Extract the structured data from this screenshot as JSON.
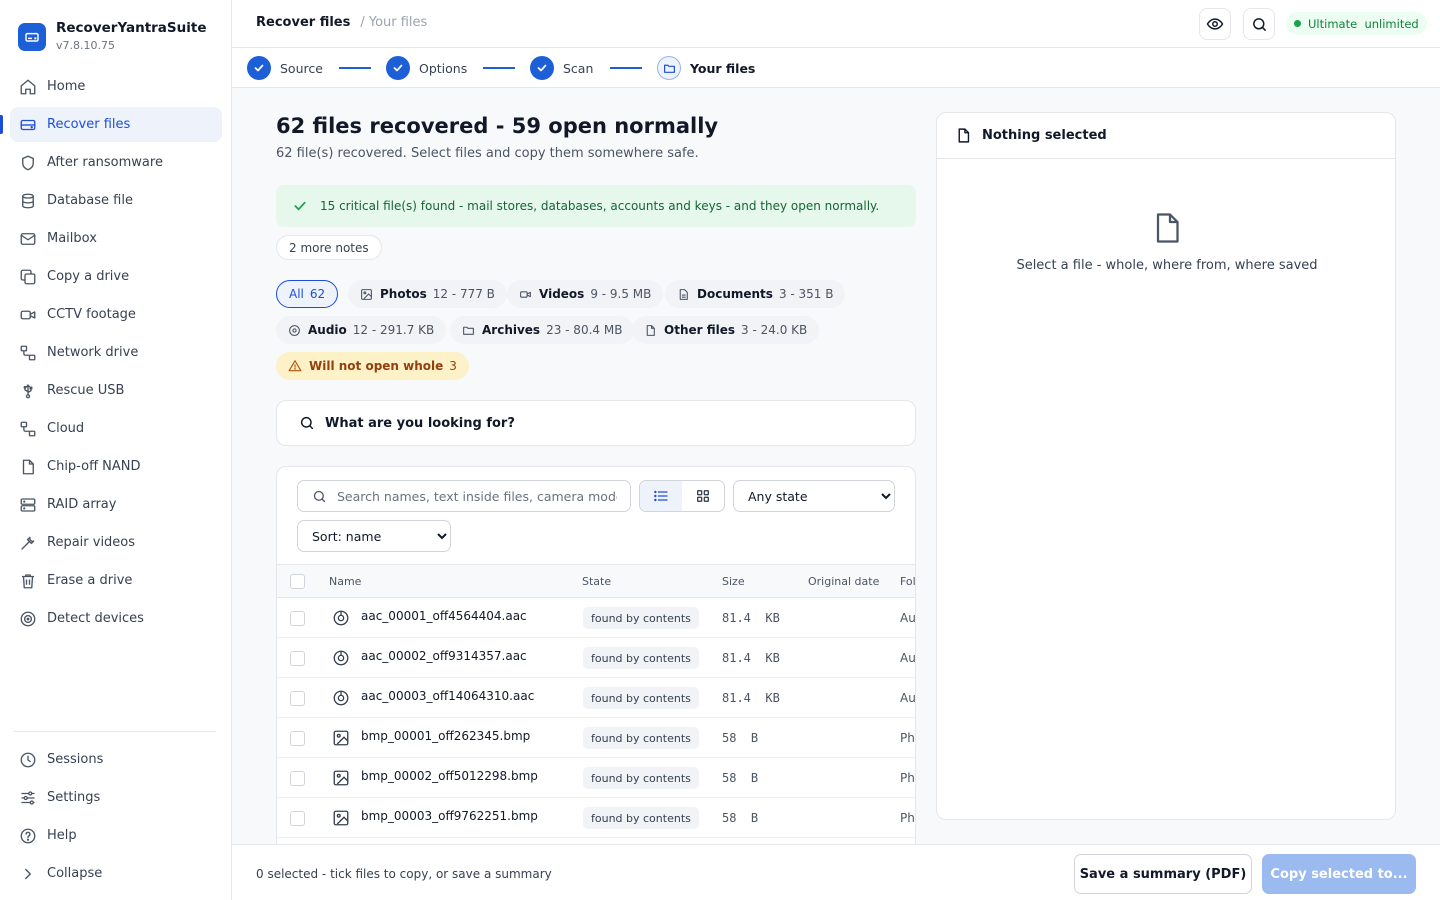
{
  "app": {
    "name": "RecoverYantraSuite",
    "version": "v7.8.10.75"
  },
  "sidebar": {
    "items": [
      {
        "label": "Home",
        "icon": "home-icon"
      },
      {
        "label": "Recover files",
        "icon": "drive-icon",
        "active": true
      },
      {
        "label": "After ransomware",
        "icon": "shield-icon"
      },
      {
        "label": "Database file",
        "icon": "database-icon"
      },
      {
        "label": "Mailbox",
        "icon": "mail-icon"
      },
      {
        "label": "Copy a drive",
        "icon": "copy-icon"
      },
      {
        "label": "CCTV footage",
        "icon": "video-icon"
      },
      {
        "label": "Network drive",
        "icon": "network-icon"
      },
      {
        "label": "Rescue USB",
        "icon": "usb-icon"
      },
      {
        "label": "Cloud",
        "icon": "network-icon"
      },
      {
        "label": "Chip-off NAND",
        "icon": "file-icon"
      },
      {
        "label": "RAID array",
        "icon": "raid-icon"
      },
      {
        "label": "Repair videos",
        "icon": "wrench-icon"
      },
      {
        "label": "Erase a drive",
        "icon": "trash-icon"
      },
      {
        "label": "Detect devices",
        "icon": "target-icon"
      }
    ],
    "bottom": [
      {
        "label": "Sessions",
        "icon": "clock-icon"
      },
      {
        "label": "Settings",
        "icon": "sliders-icon"
      },
      {
        "label": "Help",
        "icon": "help-icon"
      },
      {
        "label": "Collapse",
        "icon": "chevron-right-icon"
      }
    ]
  },
  "header": {
    "breadcrumb_main": "Recover files",
    "breadcrumb_sub": "/ Your files",
    "plan_label": "Ultimate  unlimited",
    "colors": {
      "accent": "#1d5fd6",
      "plan": "#16a34a"
    }
  },
  "stepper": {
    "steps": [
      {
        "label": "Source",
        "done": true
      },
      {
        "label": "Options",
        "done": true
      },
      {
        "label": "Scan",
        "done": true
      },
      {
        "label": "Your files",
        "done": false
      }
    ]
  },
  "main": {
    "title": "62 files recovered - 59 open normally",
    "subtitle": "62 file(s) recovered. Select files and copy them somewhere safe.",
    "alert": "15 critical file(s) found - mail stores, databases, accounts and keys - and they open normally.",
    "notes": "2 more notes",
    "chips": [
      {
        "label": "All",
        "meta": "62"
      },
      {
        "label": "Photos",
        "meta": "12 - 777 B"
      },
      {
        "label": "Videos",
        "meta": "9 - 9.5 MB"
      },
      {
        "label": "Documents",
        "meta": "3 - 351 B"
      },
      {
        "label": "Audio",
        "meta": "12 - 291.7 KB"
      },
      {
        "label": "Archives",
        "meta": "23 - 80.4 MB"
      },
      {
        "label": "Other files",
        "meta": "3 - 24.0 KB"
      },
      {
        "label": "Will not open whole",
        "meta": "3"
      }
    ],
    "lookup_label": "What are you looking for?",
    "search_placeholder": "Search names, text inside files, camera models...",
    "state_filter": {
      "options": [
        "Any state"
      ],
      "selected": "Any state"
    },
    "sort": {
      "options": [
        "Sort: name"
      ],
      "selected": "Sort: name"
    },
    "table": {
      "headers": {
        "name": "Name",
        "state": "State",
        "size": "Size",
        "date": "Original date",
        "folder": "Folder"
      },
      "rows": [
        {
          "name": "aac_00001_off4564404.aac",
          "state": "found by contents",
          "size": "81.4  KB",
          "folder": "Audio",
          "type": "audio"
        },
        {
          "name": "aac_00002_off9314357.aac",
          "state": "found by contents",
          "size": "81.4  KB",
          "folder": "Audio",
          "type": "audio"
        },
        {
          "name": "aac_00003_off14064310.aac",
          "state": "found by contents",
          "size": "81.4  KB",
          "folder": "Audio",
          "type": "audio"
        },
        {
          "name": "bmp_00001_off262345.bmp",
          "state": "found by contents",
          "size": "58  B",
          "folder": "Photos",
          "type": "image"
        },
        {
          "name": "bmp_00002_off5012298.bmp",
          "state": "found by contents",
          "size": "58  B",
          "folder": "Photos",
          "type": "image"
        },
        {
          "name": "bmp_00003_off9762251.bmp",
          "state": "found by contents",
          "size": "58  B",
          "folder": "Photos",
          "type": "image"
        }
      ]
    }
  },
  "details": {
    "title": "Nothing selected",
    "empty": "Select a file - whole, where from, where saved"
  },
  "footer": {
    "status": "0 selected - tick files to copy, or save a summary",
    "save_label": "Save a summary (PDF)",
    "copy_label": "Copy selected to..."
  }
}
